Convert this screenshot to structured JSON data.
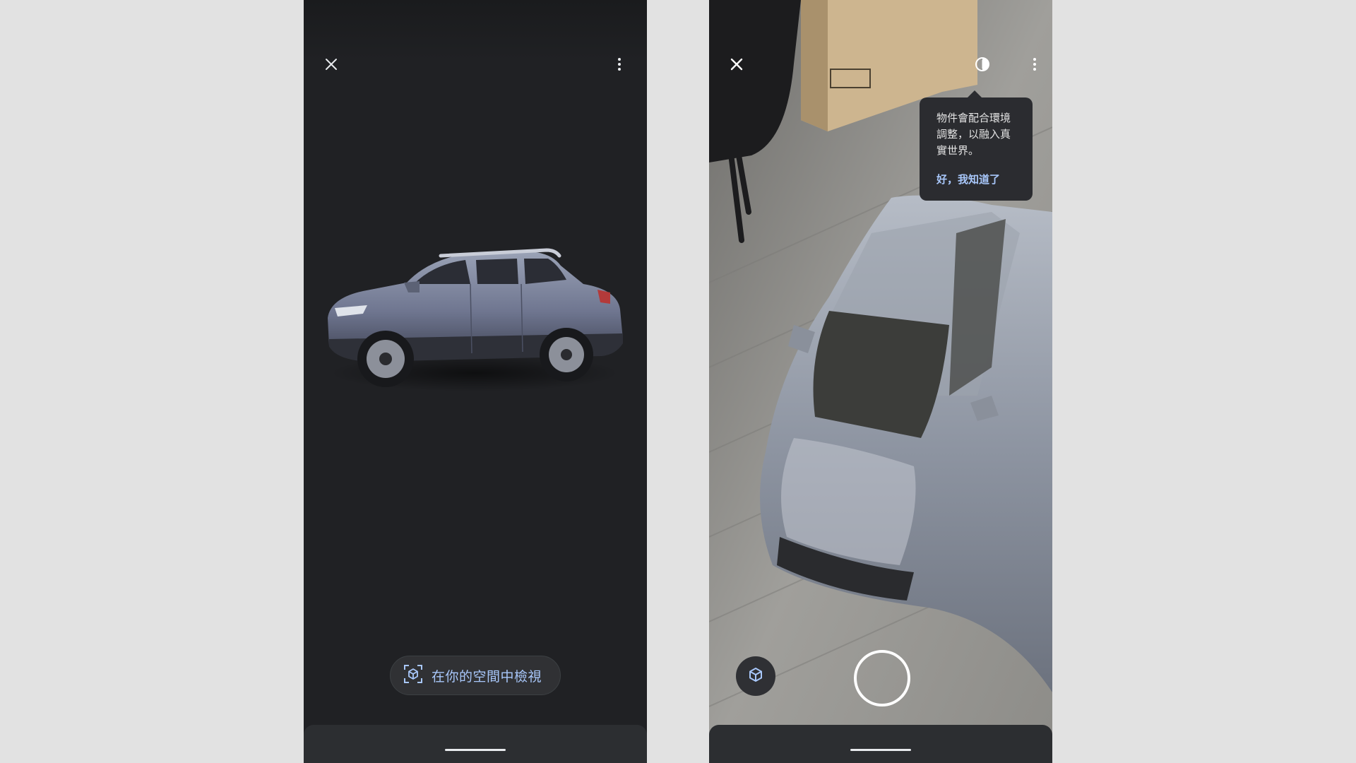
{
  "left_screen": {
    "close_icon": "close-icon",
    "menu_icon": "more-vert-icon",
    "view_in_space_button": {
      "icon": "ar-cube-icon",
      "label": "在你的空間中檢視"
    }
  },
  "right_screen": {
    "close_icon": "close-icon",
    "lighting_icon": "contrast-icon",
    "menu_icon": "more-vert-icon",
    "tooltip": {
      "text": "物件會配合環境調整，以融入真實世界。",
      "action": "好，我知道了"
    },
    "shutter_button": "shutter-button",
    "object_mode_icon": "3d-object-icon"
  },
  "colors": {
    "background": "#e2e2e2",
    "phone_dark": "#202124",
    "accent_blue": "#a8c7fa",
    "nav_bar": "#2c2e31"
  }
}
